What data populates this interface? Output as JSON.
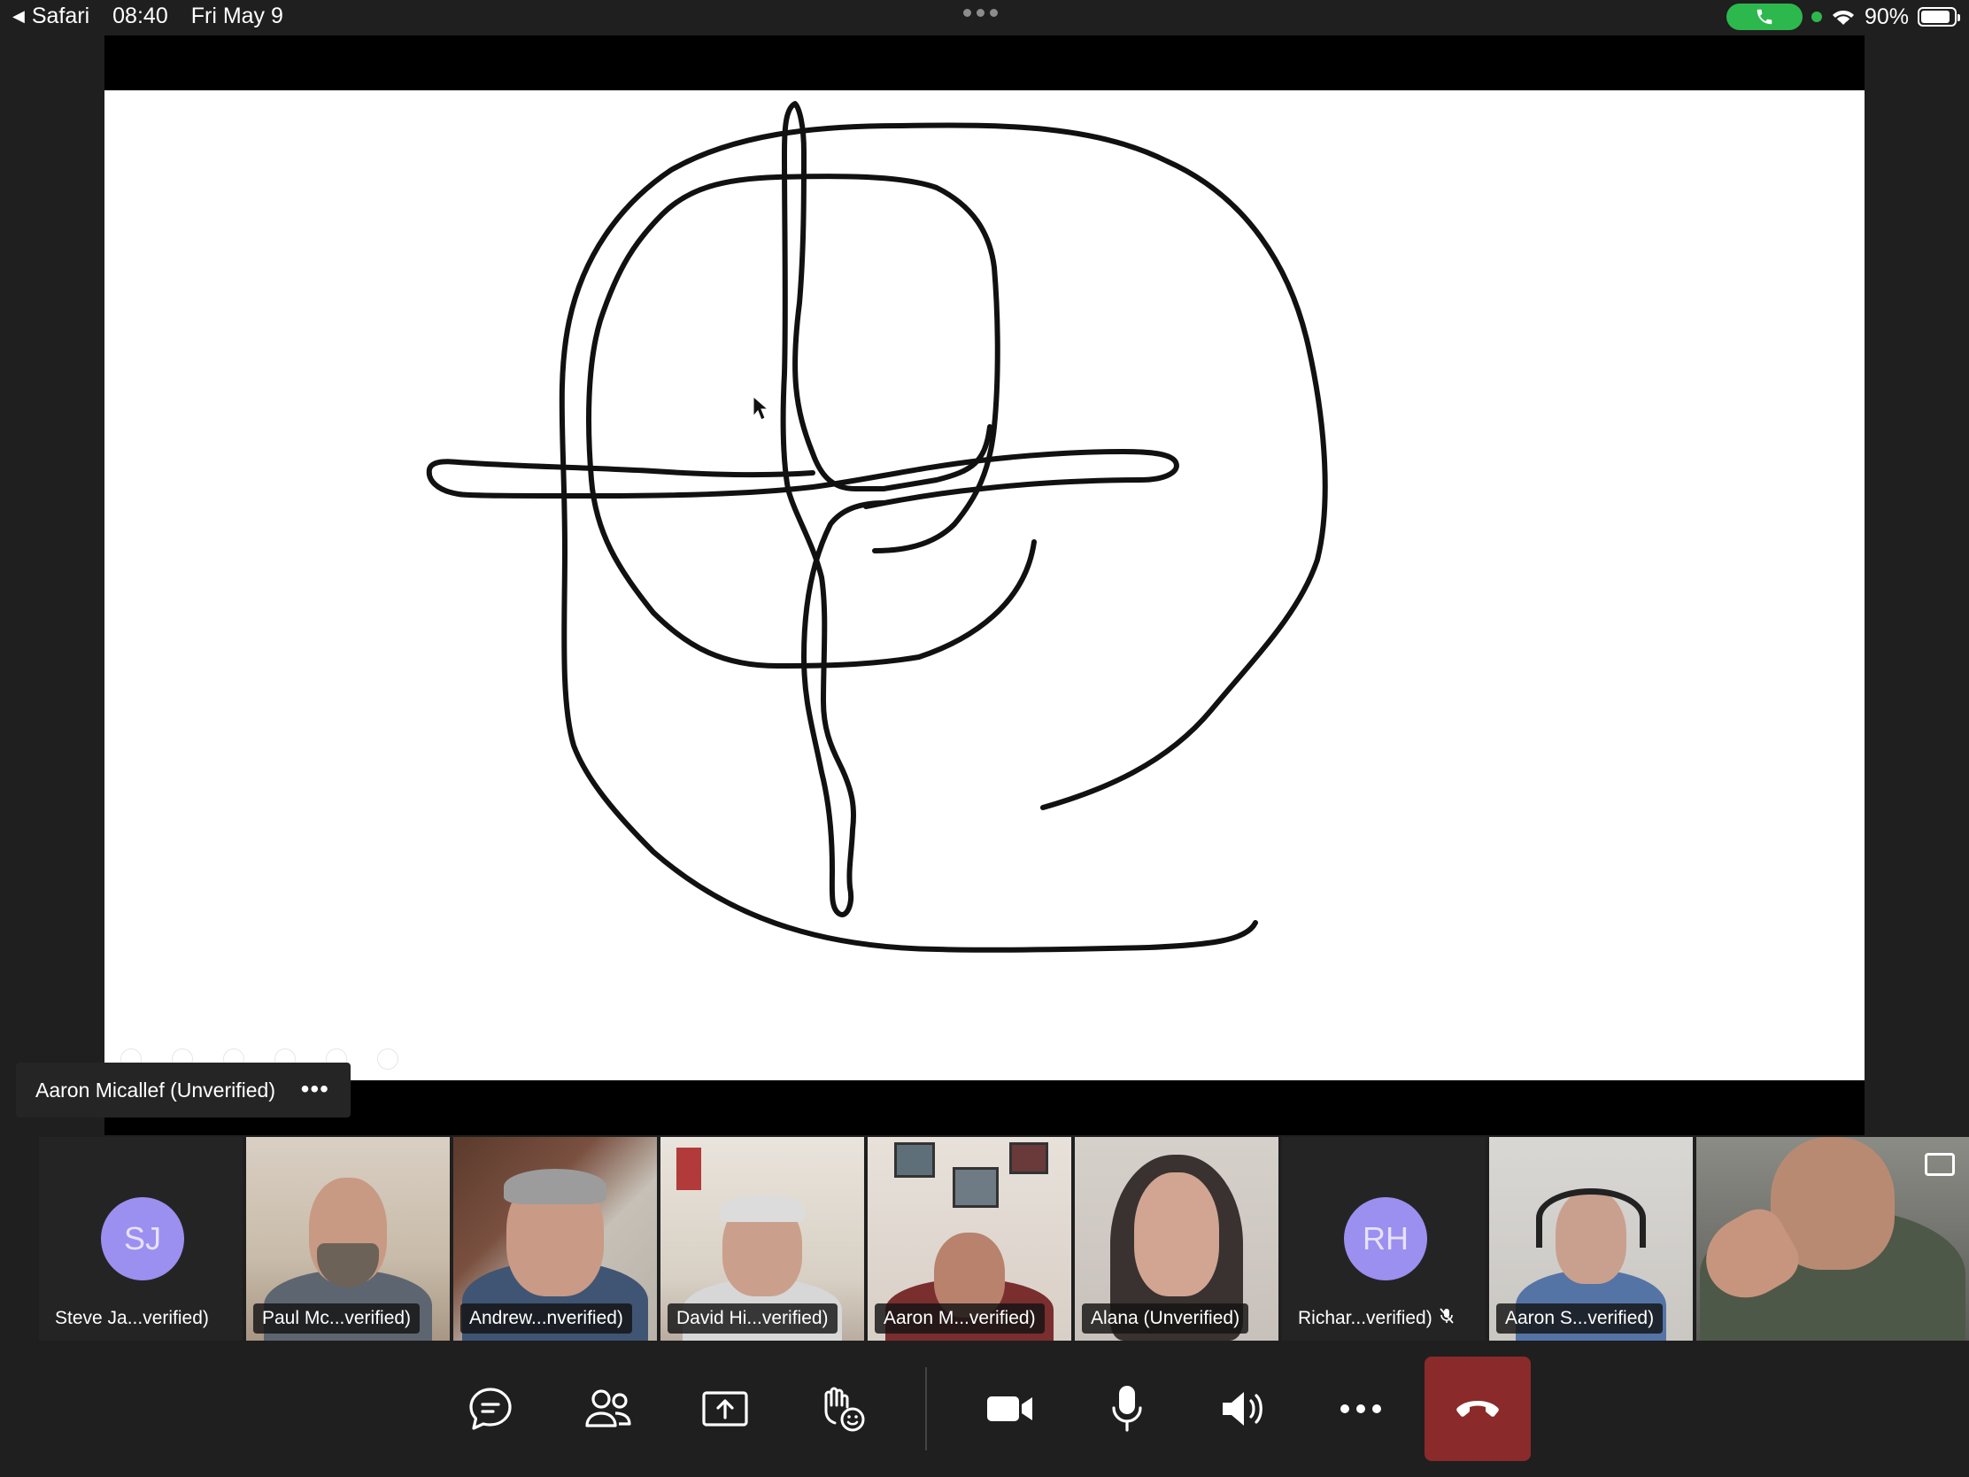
{
  "status_bar": {
    "back_app": "Safari",
    "time": "08:40",
    "date": "Fri May 9",
    "battery": "90%",
    "battery_level": 0.9
  },
  "presenter": {
    "name": "Aaron Micallef (Unverified)",
    "more": "•••"
  },
  "participants": [
    {
      "name": "Steve Ja...verified)",
      "initials": "SJ",
      "type": "avatar"
    },
    {
      "name": "Paul Mc...verified)",
      "type": "video"
    },
    {
      "name": "Andrew...nverified)",
      "type": "video"
    },
    {
      "name": "David Hi...verified)",
      "type": "video"
    },
    {
      "name": "Aaron M...verified)",
      "type": "video"
    },
    {
      "name": "Alana (Unverified)",
      "type": "video"
    },
    {
      "name": "Richar...verified)",
      "initials": "RH",
      "type": "avatar",
      "muted": true
    },
    {
      "name": "Aaron S...verified)",
      "type": "video"
    },
    {
      "name": "",
      "type": "self-video"
    }
  ],
  "toolbar": {
    "chat": "chat-icon",
    "people": "people-icon",
    "share": "share-screen-icon",
    "reactions": "raise-hand-icon",
    "camera": "video-camera-icon",
    "mic": "microphone-icon",
    "speaker": "speaker-icon",
    "more": "more-icon",
    "hangup": "hang-up-icon"
  },
  "colors": {
    "background": "#1f1f1f",
    "avatar": "#9b8ff0",
    "hangup": "#c4314b",
    "call_pill": "#2db84d"
  }
}
